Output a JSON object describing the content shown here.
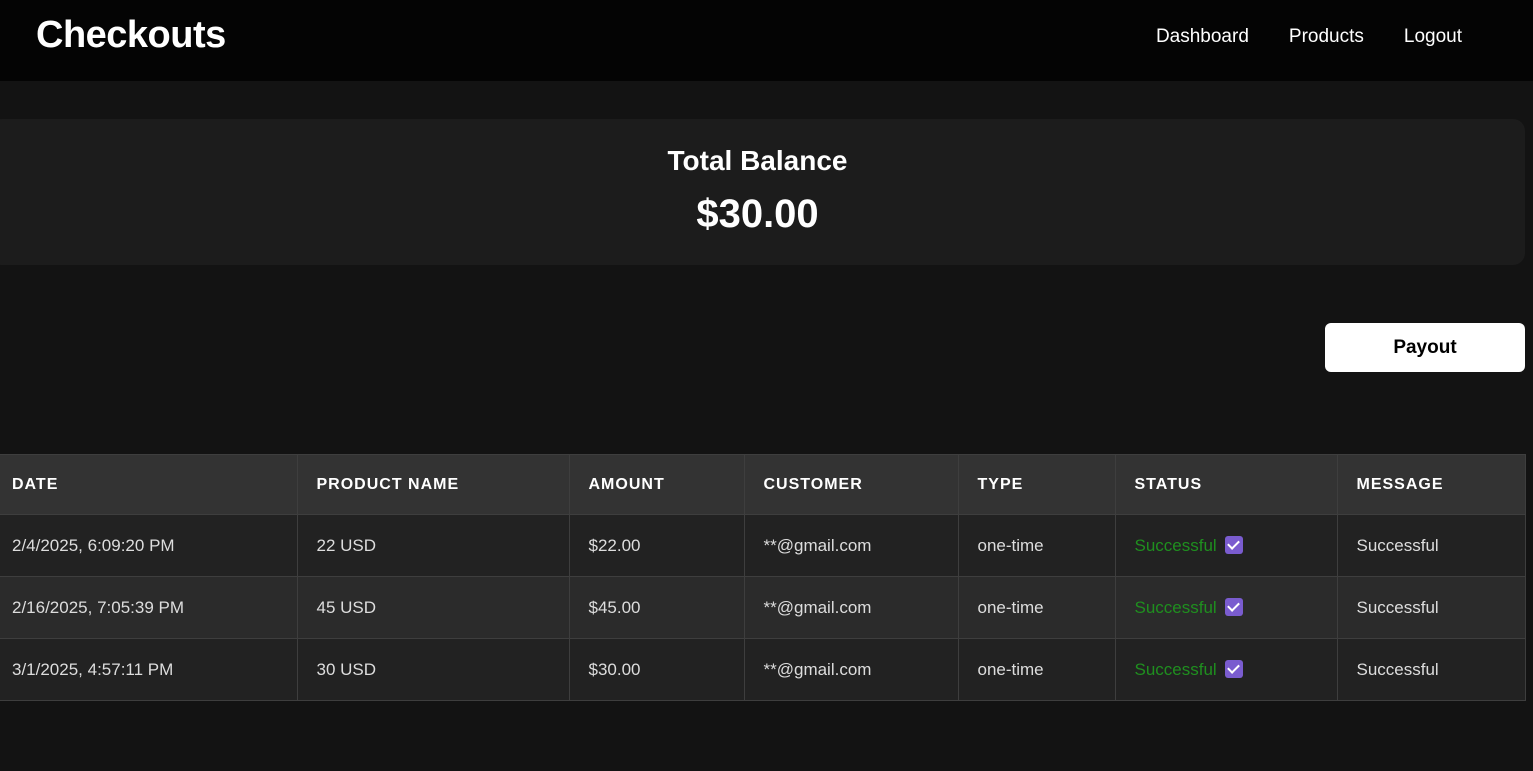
{
  "header": {
    "brand": "Checkouts",
    "nav": [
      "Dashboard",
      "Products",
      "Logout"
    ]
  },
  "balance": {
    "label": "Total Balance",
    "amount": "$30.00"
  },
  "payout": {
    "label": "Payout"
  },
  "colors": {
    "background": "#131313",
    "topbar": "#040404",
    "success": "#1f8f1f",
    "check": "#7a5ccf"
  },
  "table": {
    "columns": [
      "DATE",
      "PRODUCT NAME",
      "AMOUNT",
      "CUSTOMER",
      "TYPE",
      "STATUS",
      "MESSAGE"
    ],
    "rows": [
      {
        "date": "2/4/2025, 6:09:20 PM",
        "product": "22 USD",
        "amount": "$22.00",
        "customer": "**@gmail.com",
        "type": "one-time",
        "status": "Successful",
        "status_icon": "check-icon",
        "message": "Successful"
      },
      {
        "date": "2/16/2025, 7:05:39 PM",
        "product": "45 USD",
        "amount": "$45.00",
        "customer": "**@gmail.com",
        "type": "one-time",
        "status": "Successful",
        "status_icon": "check-icon",
        "message": "Successful"
      },
      {
        "date": "3/1/2025, 4:57:11 PM",
        "product": "30 USD",
        "amount": "$30.00",
        "customer": "**@gmail.com",
        "type": "one-time",
        "status": "Successful",
        "status_icon": "check-icon",
        "message": "Successful"
      }
    ]
  }
}
